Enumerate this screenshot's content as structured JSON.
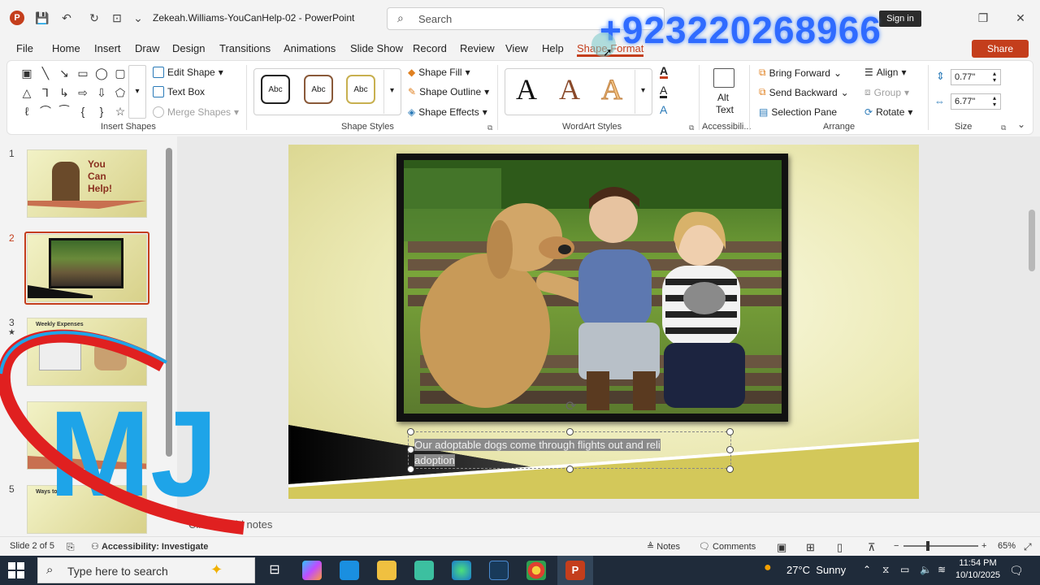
{
  "titlebar": {
    "doc_title": "Zekeah.Williams-YouCanHelp-02  -  PowerPoint",
    "search_placeholder": "Search",
    "signin_label": "Sign in",
    "overlay_phone": "+923220268966"
  },
  "menu": {
    "items": [
      "File",
      "Home",
      "Insert",
      "Draw",
      "Design",
      "Transitions",
      "Animations",
      "Slide Show",
      "Record",
      "Review",
      "View",
      "Help",
      "Shape Format"
    ],
    "share_label": "Share"
  },
  "ribbon": {
    "insert_shapes": {
      "edit_shape": "Edit Shape",
      "text_box": "Text Box",
      "merge_shapes": "Merge Shapes",
      "label": "Insert Shapes"
    },
    "shape_styles": {
      "abc": [
        "Abc",
        "Abc",
        "Abc"
      ],
      "shape_fill": "Shape Fill",
      "shape_outline": "Shape Outline",
      "shape_effects": "Shape Effects",
      "label": "Shape Styles"
    },
    "wordart": {
      "letters": [
        "A",
        "A",
        "A"
      ],
      "label": "WordArt Styles"
    },
    "accessibility": {
      "alt_text_line1": "Alt",
      "alt_text_line2": "Text",
      "label": "Accessibili..."
    },
    "arrange": {
      "bring_forward": "Bring Forward",
      "send_backward": "Send Backward",
      "selection_pane": "Selection Pane",
      "align": "Align",
      "group": "Group",
      "rotate": "Rotate",
      "label": "Arrange"
    },
    "size": {
      "height": "0.77\"",
      "width": "6.77\"",
      "label": "Size"
    }
  },
  "thumbnails": {
    "numbers": [
      "1",
      "2",
      "3",
      "4",
      "5"
    ],
    "slide1_title_lines": [
      "You",
      "Can",
      "Help!"
    ],
    "slide3_title": "Weekly Expenses",
    "slide5_title": "Ways to Help"
  },
  "slide": {
    "caption_line1": "Our adoptable dogs come through flights out and reli",
    "caption_line2": "adoption"
  },
  "notes_placeholder": "Click to add notes",
  "status": {
    "slide_of": "Slide 2 of 5",
    "accessibility": "Accessibility: Investigate",
    "notes": "Notes",
    "comments": "Comments",
    "zoom": "65%"
  },
  "taskbar": {
    "search_placeholder": "Type here to search",
    "weather_temp": "27°C",
    "weather_desc": "Sunny",
    "time": "11:54 PM",
    "date": "10/10/2025"
  },
  "colors": {
    "accent": "#c43e1c",
    "overlay_blue": "#2f6bff",
    "taskbar": "#1f2b3a"
  },
  "watermark_text": "MJ"
}
